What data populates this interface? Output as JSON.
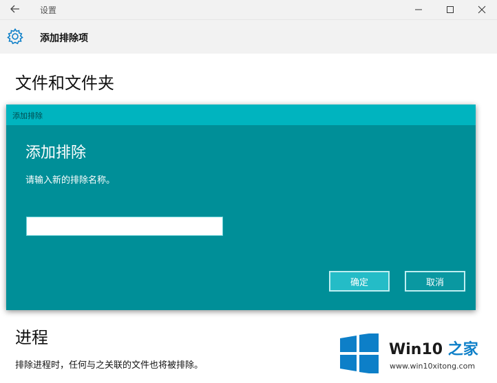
{
  "window": {
    "title": "设置",
    "page_title": "添加排除项"
  },
  "sections": {
    "files_folders": "文件和文件夹",
    "process": "进程",
    "process_desc": "排除进程时，任何与之关联的文件也将被排除。"
  },
  "dialog": {
    "caption": "添加排除",
    "heading": "添加排除",
    "prompt": "请输入新的排除名称。",
    "input_value": "",
    "ok_label": "确定",
    "cancel_label": "取消"
  },
  "watermark": {
    "brand_main": "Win10",
    "brand_accent": "之家",
    "url": "www.win10xitong.com"
  },
  "colors": {
    "titlebar_bg": "#f2f2f2",
    "dialog_bg": "#008f98",
    "dialog_caption_bg": "#00b4bf",
    "ok_button_bg": "#24bcc7",
    "accent_blue": "#0d7fc8"
  },
  "icons": {
    "back": "back-arrow-icon",
    "gear": "gear-icon",
    "minimize": "minimize-icon",
    "maximize": "maximize-icon",
    "close": "close-icon",
    "watermark_logo": "windows-logo-icon"
  }
}
